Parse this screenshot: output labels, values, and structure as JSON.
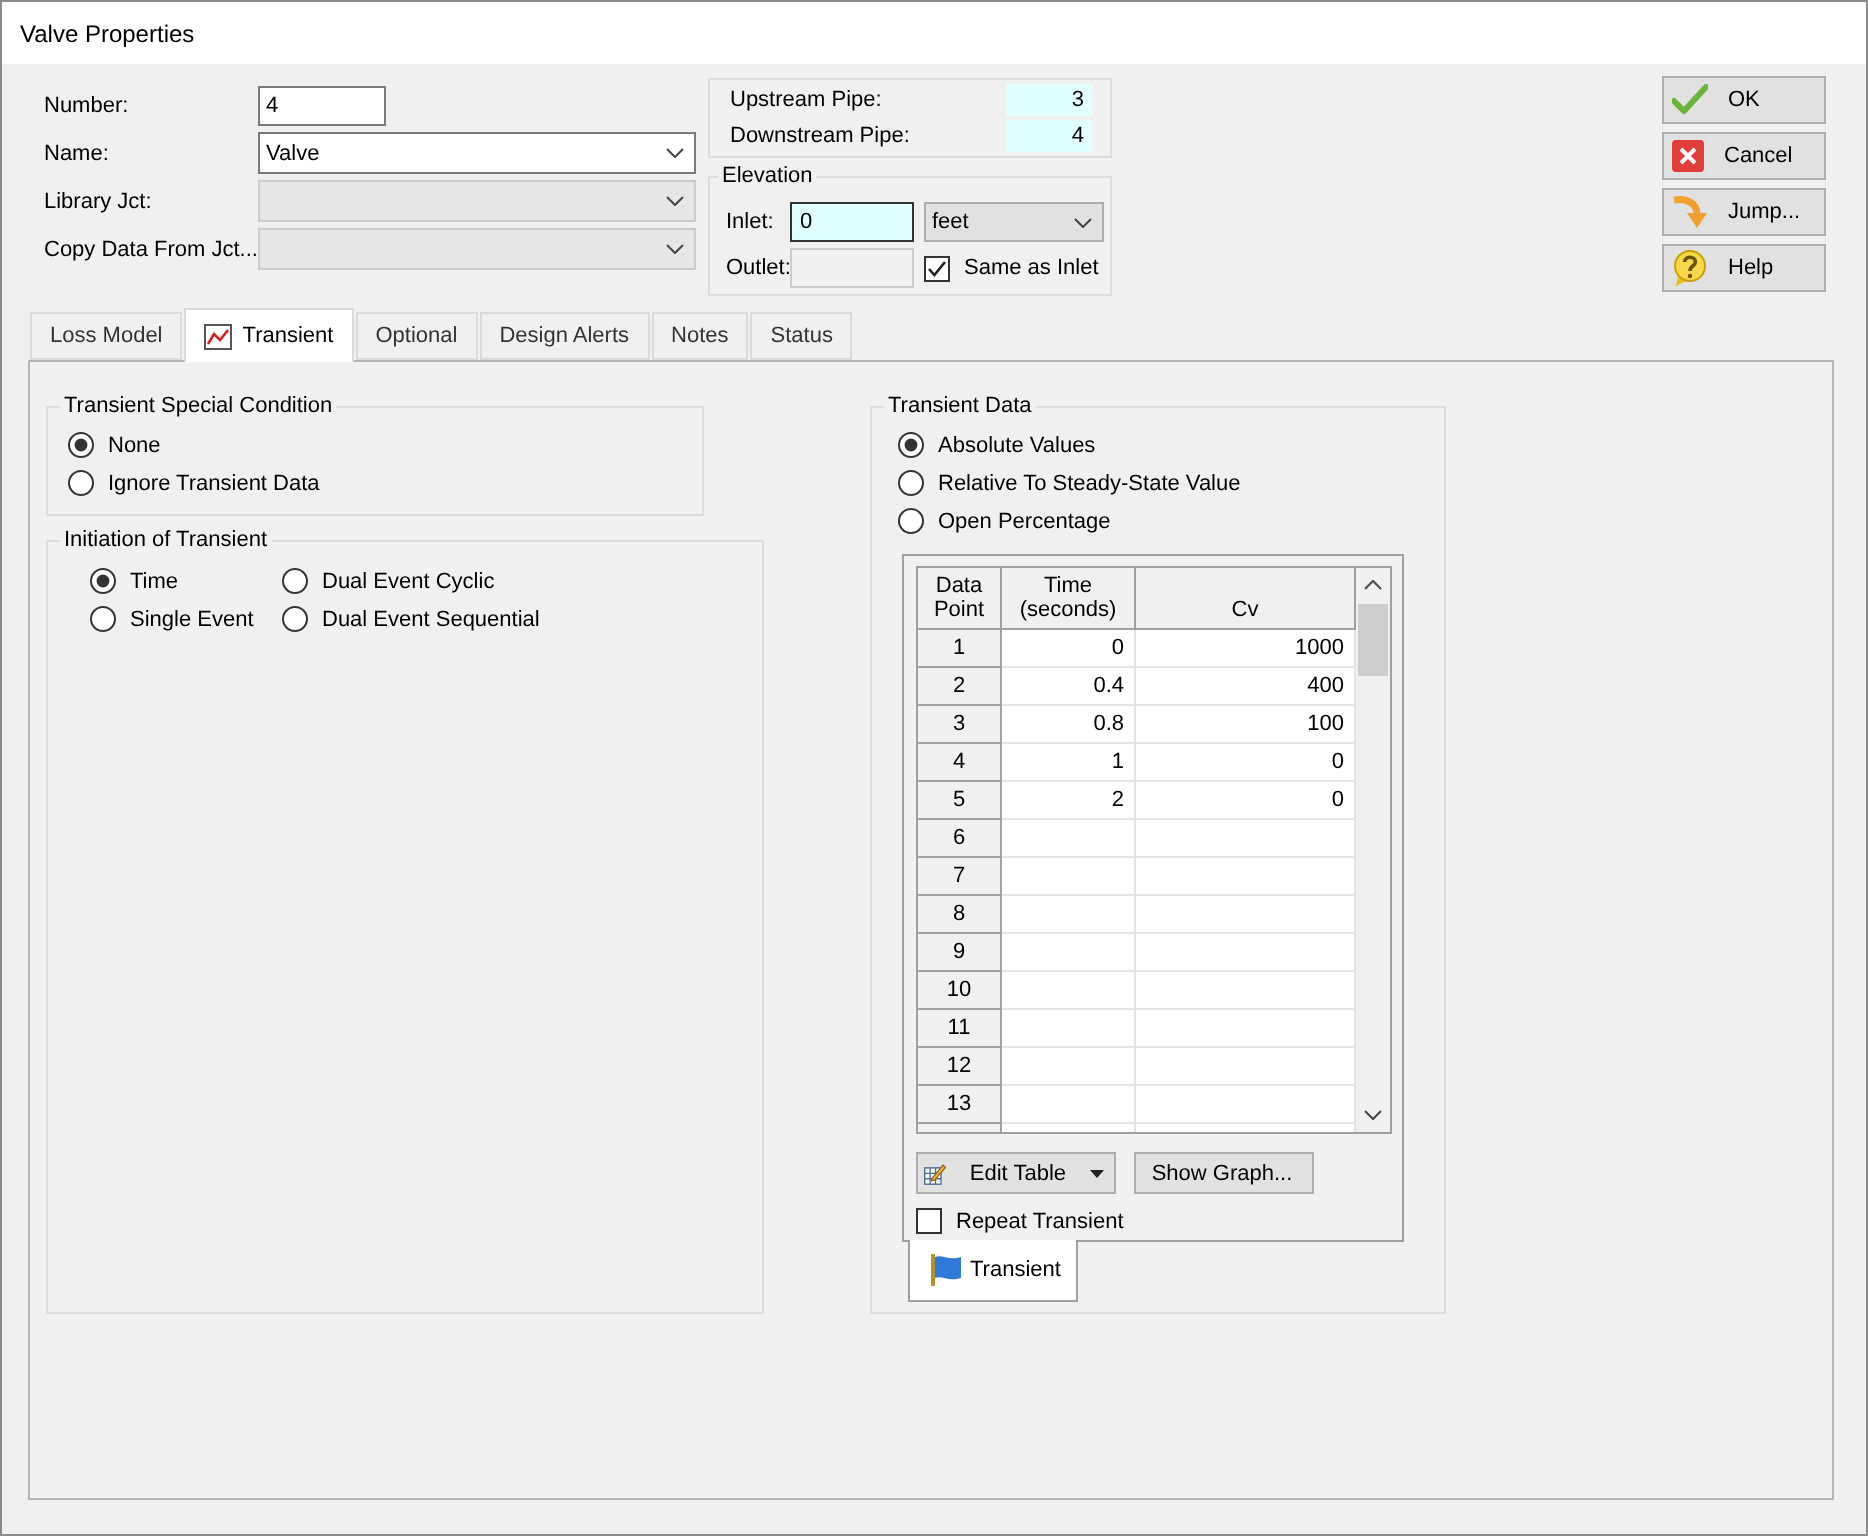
{
  "window": {
    "title": "Valve Properties"
  },
  "fields": [
    {
      "kind": "text",
      "label": "Number:",
      "value": "4"
    },
    {
      "kind": "combo",
      "label": "Name:",
      "value": "Valve",
      "disabled": false
    },
    {
      "kind": "combo",
      "label": "Library Jct:",
      "disabled": true
    },
    {
      "kind": "combo",
      "label": "Copy Data From Jct...",
      "disabled": true
    }
  ],
  "pipes": [
    {
      "label": "Upstream Pipe:",
      "value": "3"
    },
    {
      "label": "Downstream Pipe:",
      "value": "4"
    }
  ],
  "elevation": {
    "title": "Elevation",
    "inlet": {
      "label": "Inlet:",
      "value": "0"
    },
    "unit": "feet",
    "outlet": {
      "label": "Outlet:",
      "disabled": true
    },
    "same_as_inlet": {
      "label": "Same as Inlet",
      "checked": true
    }
  },
  "buttons": [
    {
      "kind": "ok",
      "label": "OK"
    },
    {
      "kind": "cancel",
      "label": "Cancel"
    },
    {
      "kind": "jump",
      "label": "Jump..."
    },
    {
      "kind": "help",
      "label": "Help"
    }
  ],
  "tabs": [
    {
      "label": "Loss Model",
      "kind": "text",
      "selected": false
    },
    {
      "label": "Transient",
      "kind": "chart",
      "selected": true
    },
    {
      "label": "Optional",
      "kind": "text",
      "selected": false
    },
    {
      "label": "Design Alerts",
      "kind": "text",
      "selected": false
    },
    {
      "label": "Notes",
      "kind": "text",
      "selected": false
    },
    {
      "label": "Status",
      "kind": "text",
      "selected": false
    }
  ],
  "special_condition": {
    "title": "Transient Special Condition",
    "options": [
      {
        "label": "None",
        "selected": true
      },
      {
        "label": "Ignore Transient Data",
        "selected": false
      }
    ]
  },
  "initiation": {
    "title": "Initiation of Transient",
    "options": [
      {
        "label": "Time",
        "selected": true
      },
      {
        "label": "Dual Event Cyclic",
        "selected": false
      },
      {
        "label": "Single Event",
        "selected": false
      },
      {
        "label": "Dual Event Sequential",
        "selected": false
      }
    ]
  },
  "transient_data": {
    "title": "Transient Data",
    "options": [
      {
        "label": "Absolute Values",
        "selected": true
      },
      {
        "label": "Relative To Steady-State Value",
        "selected": false
      },
      {
        "label": "Open Percentage",
        "selected": false
      }
    ],
    "table": {
      "columns": [
        "Data Point",
        "Time (seconds)",
        "Cv"
      ],
      "rows": [
        {
          "point": "1",
          "time": "0",
          "cv": "1000"
        },
        {
          "point": "2",
          "time": "0.4",
          "cv": "400"
        },
        {
          "point": "3",
          "time": "0.8",
          "cv": "100"
        },
        {
          "point": "4",
          "time": "1",
          "cv": "0"
        },
        {
          "point": "5",
          "time": "2",
          "cv": "0"
        },
        {
          "point": "6"
        },
        {
          "point": "7"
        },
        {
          "point": "8"
        },
        {
          "point": "9"
        },
        {
          "point": "10"
        },
        {
          "point": "11"
        },
        {
          "point": "12"
        },
        {
          "point": "13"
        }
      ]
    },
    "edit_table": "Edit Table",
    "show_graph": "Show Graph...",
    "repeat_transient": {
      "label": "Repeat Transient",
      "checked": false
    },
    "bottom_tab": {
      "label": "Transient",
      "selected": true
    }
  }
}
